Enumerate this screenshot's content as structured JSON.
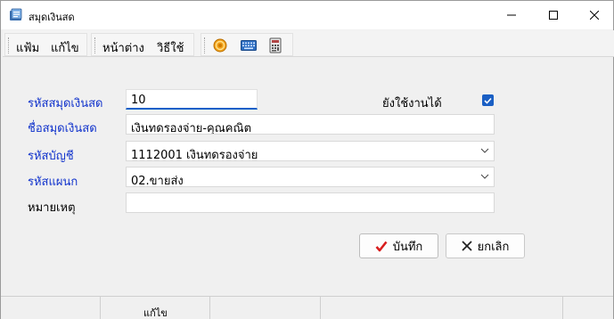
{
  "window": {
    "title": "สมุดเงินสด",
    "minimize_icon": "minimize-icon",
    "maximize_icon": "maximize-icon",
    "close_icon": "close-icon"
  },
  "menubar": {
    "items": [
      "แฟ้ม",
      "แก้ไข",
      "หน้าต่าง",
      "วิธีใช้"
    ],
    "tools": [
      "coin-icon",
      "keyboard-icon",
      "calculator-icon"
    ]
  },
  "form": {
    "code_label": "รหัสสมุดเงินสด",
    "code_value": "10",
    "active_label": "ยังใช้งานได้",
    "active_checked": true,
    "name_label": "ชื่อสมุดเงินสด",
    "name_value": "เงินทดรองจ่าย-คุณคณิต",
    "account_label": "รหัสบัญชี",
    "account_value": "1112001 เงินทดรองจ่าย",
    "department_label": "รหัสแผนก",
    "department_value": "02.ขายส่ง",
    "remark_label": "หมายเหตุ",
    "remark_value": ""
  },
  "buttons": {
    "save_label": "บันทึก",
    "cancel_label": "ยกเลิก"
  },
  "statusbar": {
    "mode_text": "แก้ไข"
  },
  "colors": {
    "label_blue": "#1133cc",
    "focus_blue": "#0a5fc8",
    "check_red": "#d81e1e"
  }
}
